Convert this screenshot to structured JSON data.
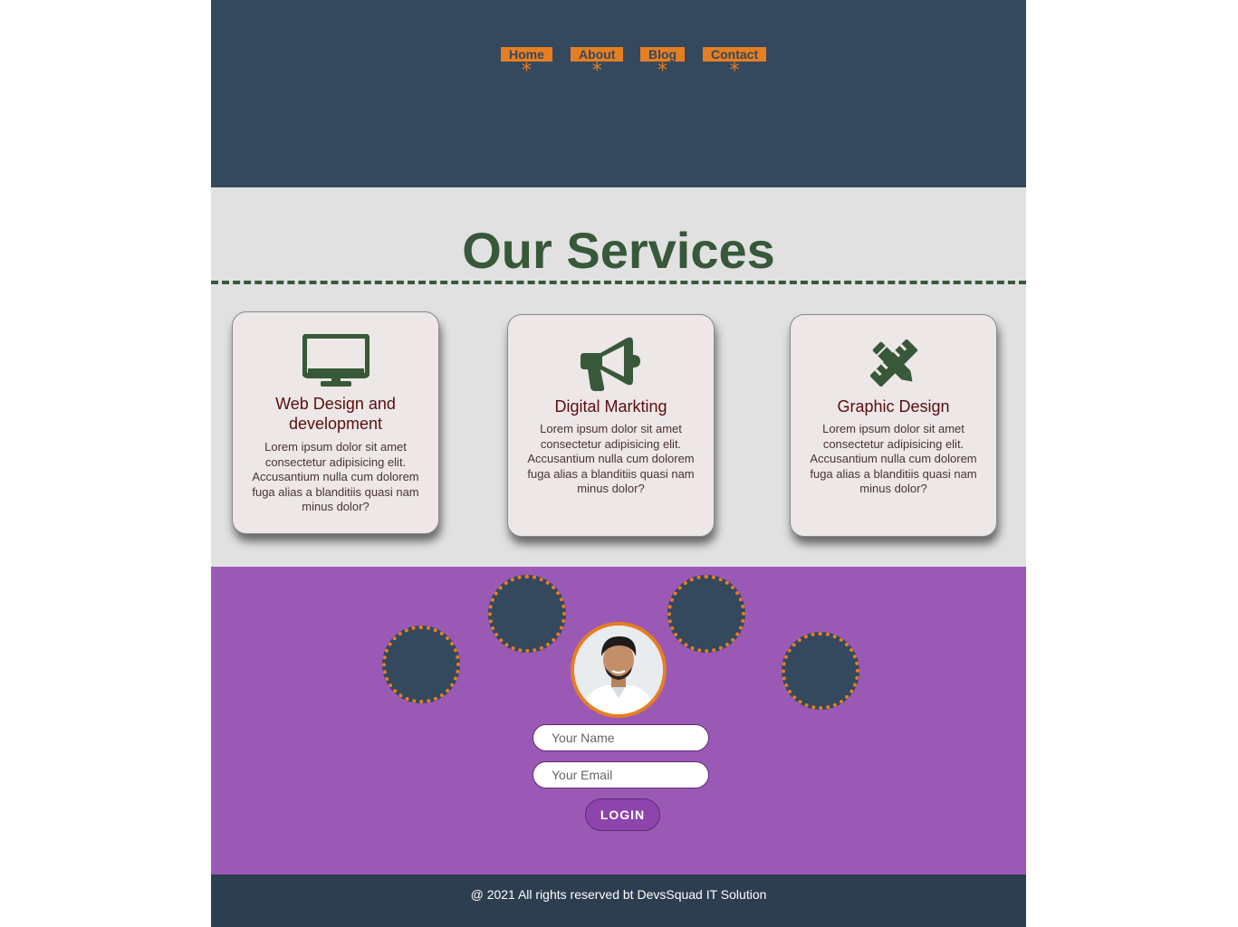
{
  "colors": {
    "header_bg": "#34495e",
    "nav_button_bg": "#e67e22",
    "accent_green": "#375839",
    "services_bg": "#e1e1e1",
    "card_bg": "#ede7e7",
    "card_title": "#5a0d0d",
    "login_bg": "#9b59b6",
    "circle_fill": "#34495e",
    "circle_dots": "#e67e22",
    "login_button_bg": "#8e44ad",
    "footer_bg": "#2c3e50"
  },
  "nav": {
    "items": [
      {
        "label": "Home",
        "marker": "*"
      },
      {
        "label": "About",
        "marker": "*"
      },
      {
        "label": "Blog",
        "marker": "*"
      },
      {
        "label": "Contact",
        "marker": "*"
      }
    ]
  },
  "services": {
    "title": "Our Services",
    "cards": [
      {
        "icon": "desktop-monitor-icon",
        "title": "Web Design and development",
        "text": "Lorem ipsum dolor sit amet consectetur adipisicing elit. Accusantium nulla cum dolorem fuga alias a blanditiis quasi nam minus dolor?"
      },
      {
        "icon": "megaphone-icon",
        "title": "Digital Markting",
        "text": "Lorem ipsum dolor sit amet consectetur adipisicing elit. Accusantium nulla cum dolorem fuga alias a blanditiis quasi nam minus dolor?"
      },
      {
        "icon": "pencil-ruler-icon",
        "title": "Graphic Design",
        "text": "Lorem ipsum dolor sit amet consectetur adipisicing elit. Accusantium nulla cum dolorem fuga alias a blanditiis quasi nam minus dolor?"
      }
    ]
  },
  "login": {
    "name_placeholder": "Your Name",
    "email_placeholder": "Your Email",
    "button_label": "LOGIN"
  },
  "footer": {
    "text": "@ 2021 All rights reserved bt DevsSquad IT Solution"
  }
}
